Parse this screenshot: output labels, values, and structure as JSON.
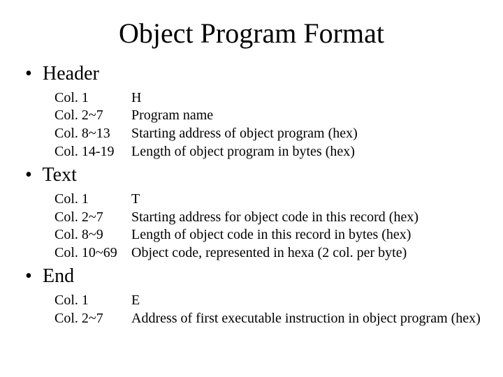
{
  "title": "Object Program Format",
  "sections": [
    {
      "label": "Header",
      "rows": [
        {
          "col": "Col. 1",
          "desc": "H"
        },
        {
          "col": "Col. 2~7",
          "desc": "Program name"
        },
        {
          "col": "Col. 8~13",
          "desc": "Starting address of object program (hex)"
        },
        {
          "col": "Col. 14-19",
          "desc": "Length of object program in bytes (hex)"
        }
      ]
    },
    {
      "label": "Text",
      "rows": [
        {
          "col": "Col. 1",
          "desc": "T"
        },
        {
          "col": "Col. 2~7",
          "desc": "Starting address for object code in this record (hex)"
        },
        {
          "col": "Col. 8~9",
          "desc": "Length of object code in this record in bytes (hex)"
        },
        {
          "col": "Col. 10~69",
          "desc": "Object code, represented in hexa (2 col. per byte)"
        }
      ]
    },
    {
      "label": "End",
      "rows": [
        {
          "col": "Col. 1",
          "desc": "E"
        },
        {
          "col": "Col. 2~7",
          "desc": "Address of first executable instruction in object program  (hex)"
        }
      ]
    }
  ]
}
